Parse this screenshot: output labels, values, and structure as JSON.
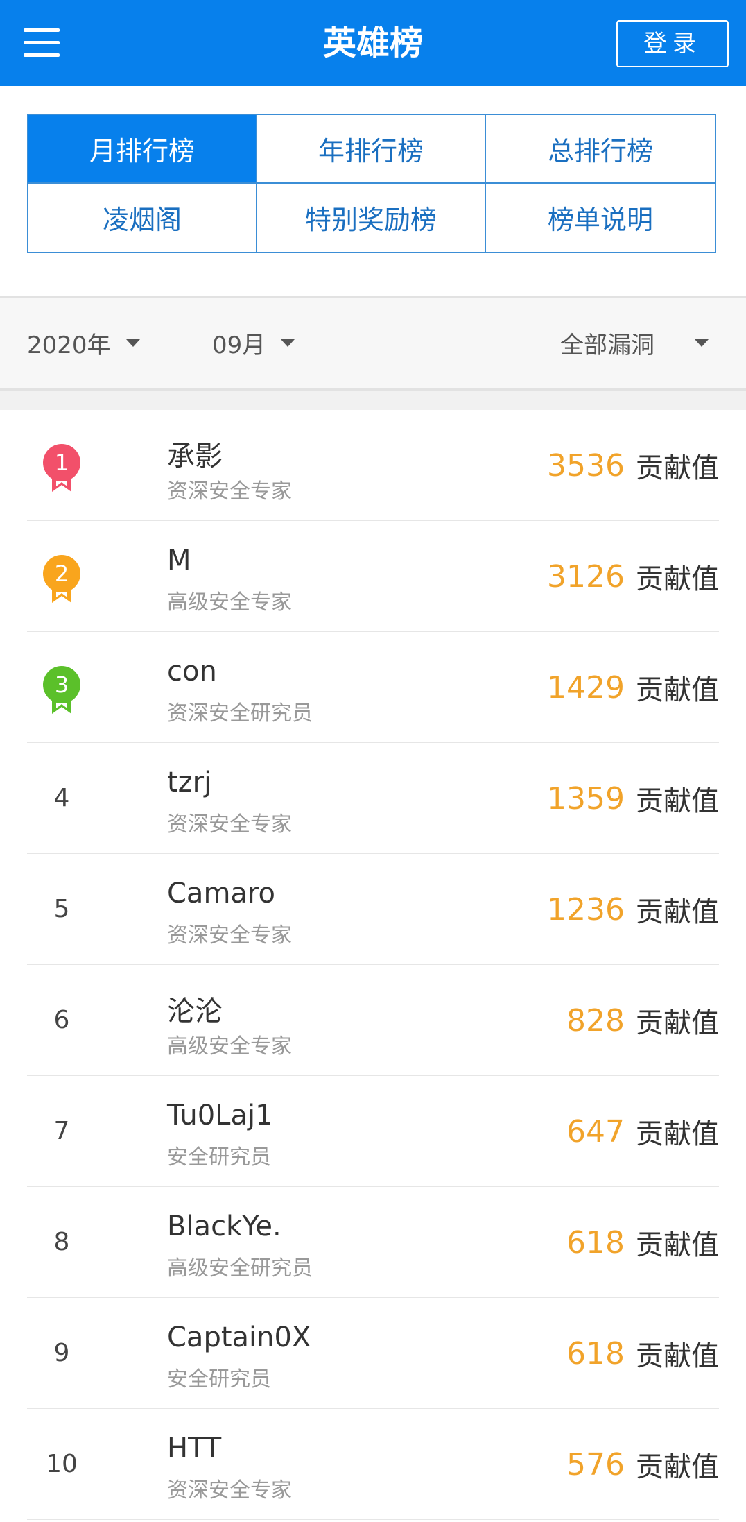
{
  "header": {
    "title": "英雄榜",
    "login_label": "登录",
    "menu_icon": "hamburger-menu-icon",
    "bg_color": "#0780ec"
  },
  "tabs": [
    {
      "label": "月排行榜",
      "active": true
    },
    {
      "label": "年排行榜",
      "active": false
    },
    {
      "label": "总排行榜",
      "active": false
    },
    {
      "label": "凌烟阁",
      "active": false
    },
    {
      "label": "特别奖励榜",
      "active": false
    },
    {
      "label": "榜单说明",
      "active": false
    }
  ],
  "filters": {
    "year": "2020年",
    "month": "09月",
    "type": "全部漏洞"
  },
  "score_unit": "贡献值",
  "medal_colors": {
    "1": "#f2506a",
    "2": "#f9a51d",
    "3": "#5bc02a"
  },
  "score_color": "#f1a32a",
  "leaderboard": [
    {
      "rank": "1",
      "name": "承影",
      "title": "资深安全专家",
      "score": "3536"
    },
    {
      "rank": "2",
      "name": "M",
      "title": "高级安全专家",
      "score": "3126"
    },
    {
      "rank": "3",
      "name": "con",
      "title": "资深安全研究员",
      "score": "1429"
    },
    {
      "rank": "4",
      "name": "tzrj",
      "title": "资深安全专家",
      "score": "1359"
    },
    {
      "rank": "5",
      "name": "Camaro",
      "title": "资深安全专家",
      "score": "1236"
    },
    {
      "rank": "6",
      "name": "沦沦",
      "title": "高级安全专家",
      "score": "828"
    },
    {
      "rank": "7",
      "name": "Tu0Laj1",
      "title": "安全研究员",
      "score": "647"
    },
    {
      "rank": "8",
      "name": "BlackYe.",
      "title": "高级安全研究员",
      "score": "618"
    },
    {
      "rank": "9",
      "name": "Captain0X",
      "title": "安全研究员",
      "score": "618"
    },
    {
      "rank": "10",
      "name": "HTT",
      "title": "资深安全专家",
      "score": "576"
    }
  ]
}
